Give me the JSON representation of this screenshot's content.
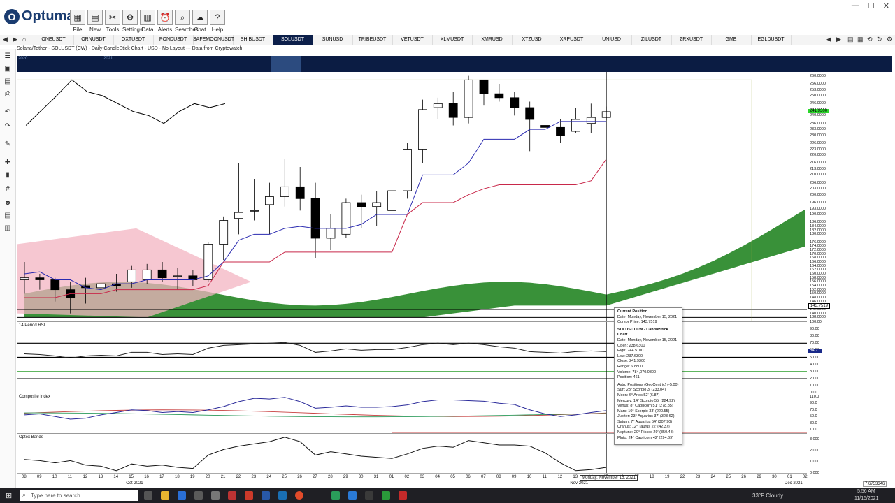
{
  "app": {
    "name": "Optuma"
  },
  "window_controls": [
    "—",
    "☐",
    "✕"
  ],
  "toolbar": [
    {
      "label": "File",
      "icon": "folder-icon"
    },
    {
      "label": "New",
      "icon": "new-doc-icon"
    },
    {
      "label": "Tools",
      "icon": "tools-icon"
    },
    {
      "label": "Settings",
      "icon": "gear-icon"
    },
    {
      "label": "Data",
      "icon": "data-icon"
    },
    {
      "label": "Alerts",
      "icon": "alarm-icon"
    },
    {
      "label": "Searches",
      "icon": "search-icon"
    },
    {
      "label": "Chat",
      "icon": "chat-icon"
    },
    {
      "label": "Help",
      "icon": "help-icon"
    }
  ],
  "tabs": [
    "ONEUSDT",
    "ORNUSDT",
    "OXTUSDT",
    "PONDUSDT",
    "SAFEMOONUSDT",
    "SHIBUSDT",
    "SOLUSDT",
    "SUNUSD",
    "TRIBEUSDT",
    "VETUSDT",
    "XLMUSDT",
    "XMRUSD",
    "XTZUSD",
    "XRPUSDT",
    "UNIUSD",
    "ZILUSDT",
    "ZRXUSDT",
    "GME",
    "EGLDUSDT"
  ],
  "active_tab": "SOLUSDT",
  "chart_title": "Solana/Tether - SOLUSDT (CW) - Daily CandleStick Chart - USD - No Layout --- Data from Cryptowatch",
  "overview_labels": [
    "2020",
    "2021"
  ],
  "pane_labels": {
    "rsi": "14 Period RSI",
    "composite": "Composite Index",
    "optex": "Optex Bands"
  },
  "price_axis": [
    "260.0000",
    "256.0000",
    "253.0000",
    "250.0000",
    "246.0000",
    "243.0000",
    "240.0000",
    "236.0000",
    "233.0000",
    "230.0000",
    "226.0000",
    "223.0000",
    "220.0000",
    "216.0000",
    "213.0000",
    "210.0000",
    "206.0000",
    "203.0000",
    "200.0000",
    "196.0000",
    "193.0000",
    "190.0000",
    "186.0000",
    "184.0000",
    "182.0000",
    "180.0000",
    "176.0000",
    "174.0000",
    "172.0000",
    "170.0000",
    "168.0000",
    "166.0000",
    "164.0000",
    "162.0000",
    "160.0000",
    "158.0000",
    "156.0000",
    "154.0000",
    "152.0000",
    "150.0000",
    "148.0000",
    "146.0000",
    "144.0000",
    "142.0000",
    "140.0000",
    "138.0000"
  ],
  "last_price_tag": "241.9300",
  "cursor_price_tag": "143.7519",
  "rsi_axis": [
    "100.00",
    "90.00",
    "80.00",
    "70.00",
    "60.00",
    "50.00",
    "40.00",
    "30.00",
    "20.00",
    "10.00",
    "0.00"
  ],
  "rsi_tag": "54.71",
  "composite_axis": [
    "110.0",
    "90.0",
    "70.0",
    "50.0",
    "30.0",
    "10.0"
  ],
  "optex_axis": [
    "3.000",
    "2.000",
    "1.000",
    "0.000"
  ],
  "x_days": [
    "08",
    "09",
    "10",
    "11",
    "12",
    "13",
    "14",
    "15",
    "16",
    "17",
    "18",
    "19",
    "20",
    "21",
    "22",
    "23",
    "24",
    "25",
    "26",
    "27",
    "28",
    "29",
    "30",
    "31",
    "01",
    "02",
    "03",
    "04",
    "05",
    "06",
    "07",
    "08",
    "09",
    "10",
    "11",
    "12",
    "13",
    "14",
    "15",
    "16",
    "17",
    "18",
    "19",
    "22",
    "23",
    "24",
    "25",
    "26",
    "29",
    "30",
    "01",
    "02"
  ],
  "x_months": [
    {
      "label": "Oct 2021",
      "day_index": 7
    },
    {
      "label": "Nov 2021",
      "day_index": 36
    },
    {
      "label": "Dec 2021",
      "day_index": 50
    }
  ],
  "cursor_date_tag": "Monday, November 15, 2021",
  "bottom_right_tag": "7.6753346",
  "popup": {
    "heading": "Current Position",
    "date": "Date: Monday, November 15, 2021",
    "cursor_price": "Cursor Price: 143.7519",
    "section2": "SOLUSDT.CW - CandleStick Chart",
    "lines": [
      "Date: Monday, November 15, 2021",
      "Open: 238.6300",
      "High: 244.5100",
      "Low: 237.6300",
      "Close: 241.9300",
      "Range: 6.8800",
      "Volume: 784,070.0800",
      "Position: 461"
    ],
    "astro_heading": "Astro Positions (GeoCentric) (-5:00)",
    "astro": [
      "Sun: 23° Scorpio 3' (233.04)",
      "Moon: 6° Aries 52' (6.87)",
      "Mercury: 14° Scorpio 55' (224.92)",
      "Venus: 8° Capricorn 51' (278.85)",
      "Mars: 10° Scorpio 33' (220.55)",
      "Jupiter: 23° Aquarius 37' (323.62)",
      "Saturn: 7° Aquarius 54' (307.90)",
      "Uranus: 12° Taurus 22' (42.37)",
      "Neptune: 20° Pisces 29' (350.48)",
      "Pluto: 24° Capricorn 42' (294.69)"
    ]
  },
  "chart_data": {
    "type": "candlestick",
    "x": [
      "2021-10-08",
      "2021-10-09",
      "2021-10-10",
      "2021-10-11",
      "2021-10-12",
      "2021-10-13",
      "2021-10-14",
      "2021-10-15",
      "2021-10-16",
      "2021-10-17",
      "2021-10-18",
      "2021-10-19",
      "2021-10-20",
      "2021-10-21",
      "2021-10-22",
      "2021-10-23",
      "2021-10-24",
      "2021-10-25",
      "2021-10-26",
      "2021-10-27",
      "2021-10-28",
      "2021-10-29",
      "2021-10-30",
      "2021-10-31",
      "2021-11-01",
      "2021-11-02",
      "2021-11-03",
      "2021-11-04",
      "2021-11-05",
      "2021-11-06",
      "2021-11-07",
      "2021-11-08",
      "2021-11-09",
      "2021-11-10",
      "2021-11-11",
      "2021-11-12",
      "2021-11-13",
      "2021-11-14",
      "2021-11-15"
    ],
    "open": [
      157,
      158,
      157,
      152,
      154,
      153,
      155,
      156,
      157,
      162,
      159,
      159,
      157,
      175,
      188,
      192,
      195,
      199,
      204,
      198,
      178,
      180,
      196,
      194,
      192,
      202,
      223,
      244,
      246,
      239,
      258,
      251,
      249,
      244,
      235,
      234,
      232,
      236,
      239
    ],
    "close": [
      158,
      157,
      152,
      148,
      153,
      155,
      154,
      162,
      162,
      158,
      159,
      157,
      175,
      187,
      191,
      192,
      199,
      204,
      198,
      178,
      183,
      196,
      194,
      196,
      202,
      223,
      243,
      246,
      239,
      258,
      251,
      249,
      244,
      238,
      234,
      230,
      238,
      239,
      241.93
    ],
    "high": [
      166,
      160,
      158,
      156,
      158,
      158,
      160,
      164,
      165,
      166,
      163,
      162,
      176,
      189,
      216,
      208,
      206,
      218,
      214,
      206,
      190,
      198,
      200,
      202,
      206,
      226,
      248,
      249,
      252,
      260,
      258,
      256,
      252,
      247,
      245,
      238,
      244,
      246,
      244.51
    ],
    "low": [
      150,
      152,
      146,
      140,
      145,
      146,
      151,
      153,
      155,
      156,
      152,
      154,
      156,
      167,
      180,
      187,
      180,
      194,
      192,
      168,
      172,
      178,
      183,
      184,
      188,
      198,
      216,
      238,
      235,
      236,
      245,
      247,
      240,
      222,
      227,
      226,
      231,
      231,
      237.63
    ],
    "ylim": [
      136,
      262
    ],
    "series": [
      {
        "name": "Conversion Line",
        "values": [
          160,
          161,
          157,
          157,
          153,
          152,
          155,
          155,
          157,
          157,
          157,
          157,
          159,
          166,
          177,
          180,
          180,
          183,
          184,
          183,
          183,
          183,
          185,
          190,
          190,
          190,
          210,
          210,
          210,
          216,
          228,
          228,
          228,
          233,
          233,
          237,
          237,
          237,
          237
        ]
      },
      {
        "name": "Base Line",
        "values": [
          148,
          148,
          148,
          150,
          150,
          150,
          152,
          152,
          152,
          152,
          152,
          152,
          154,
          166,
          166,
          166,
          166,
          171,
          171,
          171,
          171,
          171,
          171,
          171,
          171,
          190,
          196,
          196,
          196,
          200,
          203,
          205,
          205,
          205,
          205,
          205,
          205,
          207,
          218
        ]
      }
    ],
    "rsi": {
      "ylim": [
        0,
        100
      ],
      "values": [
        55,
        54,
        52,
        49,
        52,
        53,
        52,
        57,
        57,
        54,
        55,
        54,
        63,
        67,
        68,
        69,
        70,
        71,
        67,
        57,
        59,
        62,
        60,
        61,
        61,
        64,
        68,
        70,
        68,
        70,
        68,
        65,
        63,
        58,
        57,
        56,
        58,
        59,
        58
      ]
    },
    "composite": {
      "ylim": [
        0,
        120
      ],
      "values": [
        55,
        58,
        50,
        42,
        45,
        55,
        62,
        70,
        68,
        62,
        65,
        62,
        70,
        80,
        95,
        105,
        103,
        108,
        95,
        75,
        78,
        82,
        78,
        78,
        80,
        85,
        95,
        100,
        100,
        98,
        96,
        90,
        86,
        70,
        58,
        50,
        55,
        62,
        68
      ]
    },
    "optex": {
      "ylim": [
        0,
        3.5
      ],
      "values": [
        1.2,
        1.1,
        0.9,
        1.1,
        0.7,
        0.6,
        0.2,
        0.8,
        0.6,
        0.7,
        0.5,
        0.4,
        1.6,
        2.1,
        2.4,
        2.6,
        2.8,
        3.2,
        2.8,
        1.6,
        1.9,
        1.7,
        1.5,
        1.4,
        1.3,
        1.7,
        2.2,
        2.4,
        2.3,
        2.9,
        2.7,
        2.5,
        2.5,
        2.4,
        1.8,
        0.9,
        0.2,
        0.3,
        0.5
      ]
    }
  },
  "taskbar": {
    "search_placeholder": "Type here to search",
    "weather": "33°F  Cloudy",
    "time": "5:56 AM",
    "date": "11/15/2021"
  },
  "colors": {
    "up": "#ffffff",
    "down": "#000000",
    "cloud": "#2e8b2e",
    "conversion": "#2a2ab0",
    "base": "#c8284a",
    "triangle": "#f3b4c2"
  }
}
